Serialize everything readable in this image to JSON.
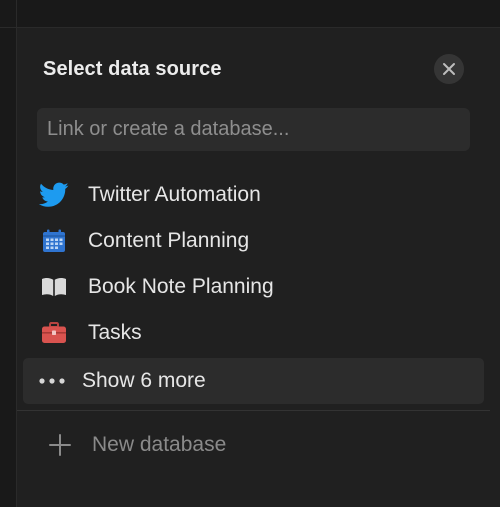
{
  "dialog": {
    "title": "Select data source",
    "close_icon": "close-icon"
  },
  "search": {
    "value": "",
    "placeholder": "Link or create a database..."
  },
  "sources": [
    {
      "label": "Twitter Automation",
      "icon": "twitter-icon",
      "color": "#1d9bf0"
    },
    {
      "label": "Content Planning",
      "icon": "calendar-icon",
      "color": "#2f74d0"
    },
    {
      "label": "Book Note Planning",
      "icon": "book-icon",
      "color": "#d9d9d9"
    },
    {
      "label": "Tasks",
      "icon": "briefcase-icon",
      "color": "#d9534f"
    }
  ],
  "show_more": {
    "label": "Show 6 more",
    "icon": "more-dots-icon"
  },
  "new_database": {
    "label": "New database",
    "icon": "plus-icon"
  },
  "colors": {
    "panel_bg": "#202020",
    "row_hover": "#2c2c2c",
    "text": "#e6e6e6",
    "muted": "#8a8a8a"
  }
}
